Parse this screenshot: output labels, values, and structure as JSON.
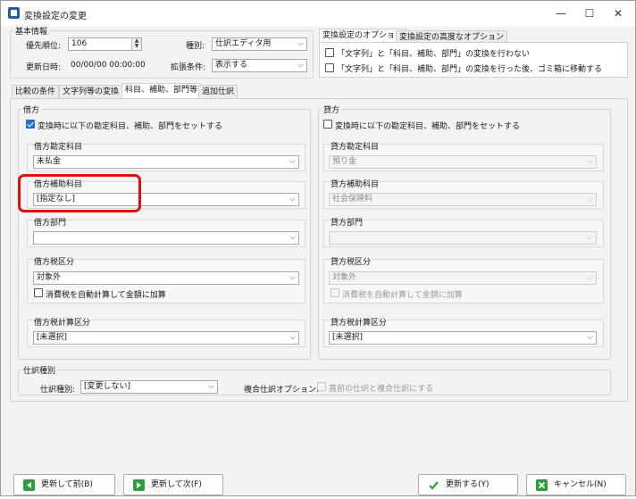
{
  "window": {
    "title": "変換設定の変更",
    "minimize": "—",
    "maximize": "☐",
    "close": "✕"
  },
  "basic": {
    "title": "基本情報",
    "priority_label": "優先順位:",
    "priority_value": "106",
    "updated_label": "更新日時:",
    "updated_value": "00/00/00 00:00:00",
    "type_label": "種別:",
    "type_value": "仕訳エディタ用",
    "ext_label": "拡張条件:",
    "ext_value": "表示する"
  },
  "options": {
    "tabs": [
      "変換設定のオプション",
      "変換設定の高度なオプション"
    ],
    "opt1": "「文字列」と「科目、補助、部門」の変換を行わない",
    "opt2": "「文字列」と「科目、補助、部門」の変換を行った後、ゴミ箱に移動する"
  },
  "main_tabs": [
    "比較の条件",
    "文字列等の変換",
    "科目、補助、部門等",
    "追加仕訳"
  ],
  "debit": {
    "title": "借方",
    "set_label": "変換時に以下の勘定科目、補助、部門をセットする",
    "account_title": "借方勘定科目",
    "account_value": "未払金",
    "sub_title": "借方補助科目",
    "sub_value": "[指定なし]",
    "dept_title": "借方部門",
    "dept_value": "",
    "tax_title": "借方税区分",
    "tax_value": "対象外",
    "tax_auto": "消費税を自動計算して金額に加算",
    "taxcalc_title": "借方税計算区分",
    "taxcalc_value": "[未選択]"
  },
  "credit": {
    "title": "貸方",
    "set_label": "変換時に以下の勘定科目、補助、部門をセットする",
    "account_title": "貸方勘定科目",
    "account_value": "預り金",
    "sub_title": "貸方補助科目",
    "sub_value": "社会保険料",
    "dept_title": "貸方部門",
    "dept_value": "",
    "tax_title": "貸方税区分",
    "tax_value": "対象外",
    "tax_auto": "消費税を自動計算して金額に加算",
    "taxcalc_title": "貸方税計算区分",
    "taxcalc_value": "[未選択]"
  },
  "journal": {
    "title": "仕訳種別",
    "kind_label": "仕訳種別:",
    "kind_value": "[変更しない]",
    "compound_label": "複合仕訳オプション:",
    "compound_opt": "直前の仕訳と複合仕訳にする"
  },
  "buttons": {
    "prev": "更新して前(B)",
    "next": "更新して次(F)",
    "ok": "更新する(Y)",
    "cancel": "キャンセル(N)"
  },
  "colors": {
    "accent": "#1e6fd0",
    "highlight": "#e01010",
    "button_green": "#2e9e3a"
  }
}
